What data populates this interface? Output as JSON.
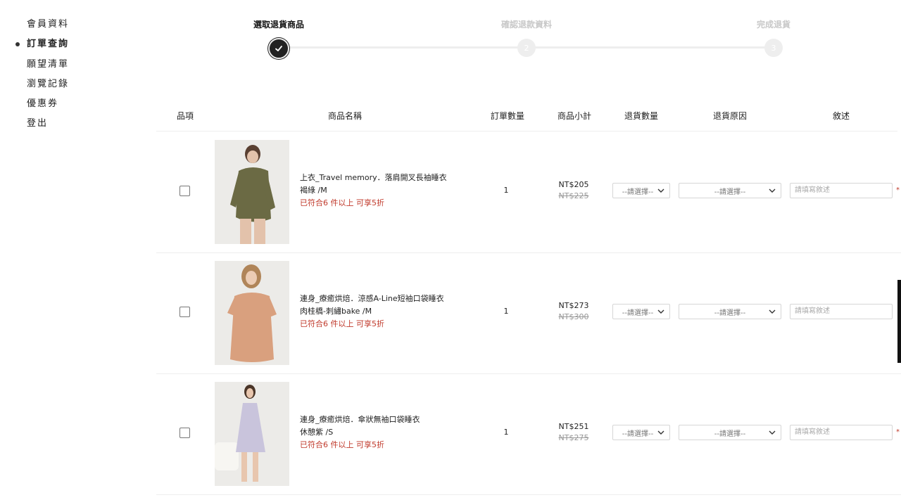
{
  "sidebar": {
    "items": [
      {
        "label": "會員資料"
      },
      {
        "label": "訂單查詢"
      },
      {
        "label": "願望清單"
      },
      {
        "label": "瀏覽記錄"
      },
      {
        "label": "優惠券"
      },
      {
        "label": "登出"
      }
    ]
  },
  "stepper": {
    "steps": [
      {
        "label": "選取退貨商品",
        "number": "",
        "state": "active"
      },
      {
        "label": "確認退款資料",
        "number": "2",
        "state": "inactive"
      },
      {
        "label": "完成退貨",
        "number": "3",
        "state": "inactive"
      }
    ]
  },
  "table": {
    "headers": [
      "品項",
      "商品名稱",
      "訂單數量",
      "商品小計",
      "退貨數量",
      "退貨原因",
      "敘述"
    ],
    "rows": [
      {
        "name": "上衣_Travel memory．落肩開叉長袖睡衣",
        "variant": "褐綠 /M",
        "promo": "已符合6 件以上 可享5折",
        "qty": "1",
        "price": "NT$205",
        "orig_price": "NT$225",
        "return_qty": "--請選擇--",
        "return_reason": "--請選擇--",
        "note_placeholder": "請填寫敘述",
        "required_mark": "*"
      },
      {
        "name": "連身_療癒烘焙．涼感A-Line短袖口袋睡衣",
        "variant": "肉桂橋-刺繡bake /M",
        "promo": "已符合6 件以上 可享5折",
        "qty": "1",
        "price": "NT$273",
        "orig_price": "NT$300",
        "return_qty": "--請選擇--",
        "return_reason": "--請選擇--",
        "note_placeholder": "請填寫敘述",
        "required_mark": ""
      },
      {
        "name": "連身_療癒烘焙．傘狀無袖口袋睡衣",
        "variant": "休憩紫 /S",
        "promo": "已符合6 件以上 可享5折",
        "qty": "1",
        "price": "NT$251",
        "orig_price": "NT$275",
        "return_qty": "--請選擇--",
        "return_reason": "--請選擇--",
        "note_placeholder": "請填寫敘述",
        "required_mark": "*"
      }
    ]
  },
  "colors": {
    "promo": "#c0392b",
    "step_active": "#222222",
    "step_inactive": "#eeeeee",
    "product_1": "#6b6a44",
    "product_2": "#d9a07e",
    "product_3": "#c9c4dc"
  }
}
